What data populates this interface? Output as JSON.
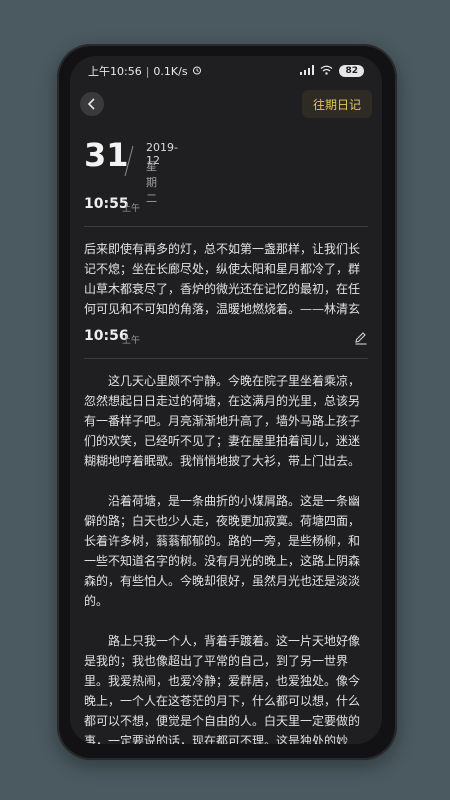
{
  "status_bar": {
    "time": "上午10:56",
    "speed": "0.1K/s",
    "battery": "82"
  },
  "header": {
    "history_button": "往期日记"
  },
  "date": {
    "day": "31",
    "year_month": "2019-12",
    "weekday": "星期二"
  },
  "entries": [
    {
      "time": "10:55",
      "ampm": "上午",
      "paragraphs": [
        "后来即使有再多的灯，总不如第一盏那样，让我们长记不熄；坐在长廊尽处，纵使太阳和星月都冷了，群山草木都衰尽了，香炉的微光还在记忆的最初，在任何可见和不可知的角落，温暖地燃烧着。——林清玄"
      ]
    },
    {
      "time": "10:56",
      "ampm": "上午",
      "paragraphs": [
        "这几天心里颇不宁静。今晚在院子里坐着乘凉，忽然想起日日走过的荷塘，在这满月的光里，总该另有一番样子吧。月亮渐渐地升高了，墙外马路上孩子们的欢笑，已经听不见了；妻在屋里拍着闰儿，迷迷糊糊地哼着眠歌。我悄悄地披了大衫，带上门出去。",
        "沿着荷塘，是一条曲折的小煤屑路。这是一条幽僻的路；白天也少人走，夜晚更加寂寞。荷塘四面，长着许多树，蓊蓊郁郁的。路的一旁，是些杨柳，和一些不知道名字的树。没有月光的晚上，这路上阴森森的，有些怕人。今晚却很好，虽然月光也还是淡淡的。",
        "路上只我一个人，背着手踱着。这一片天地好像是我的；我也像超出了平常的自己，到了另一世界里。我爱热闹，也爱冷静；爱群居，也爱独处。像今晚上，一个人在这苍茫的月下，什么都可以想，什么都可以不想，便觉是个自由的人。白天里一定要做的事，一定要说的话，现在都可不理。这是独处的妙处，我且受用这无边的荷香月色好了。"
      ]
    }
  ]
}
